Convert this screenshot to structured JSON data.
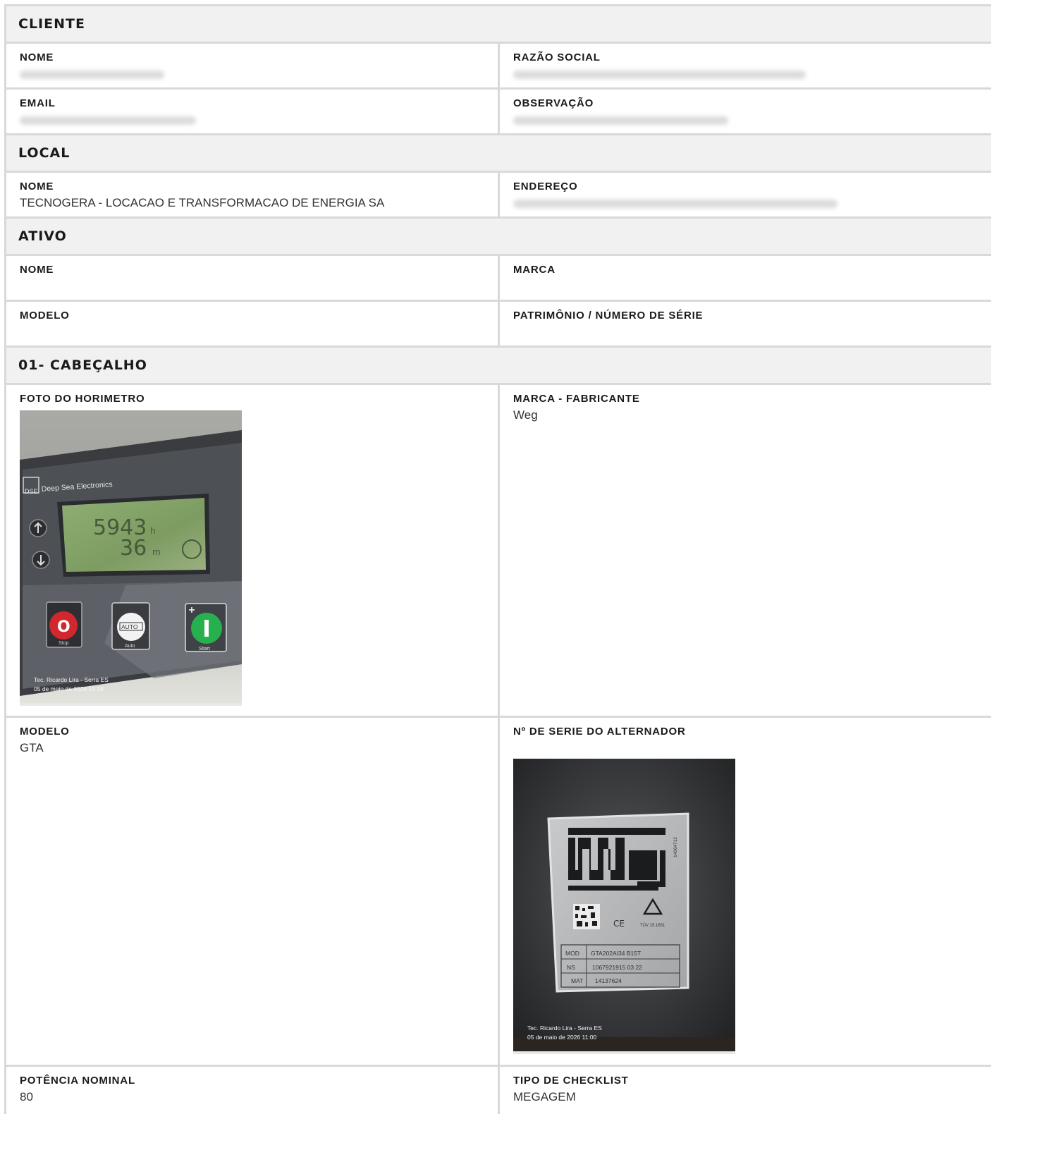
{
  "cliente": {
    "title": "CLIENTE",
    "nome_label": "NOME",
    "razao_label": "RAZÃO SOCIAL",
    "email_label": "EMAIL",
    "obs_label": "OBSERVAÇÃO"
  },
  "local": {
    "title": "LOCAL",
    "nome_label": "NOME",
    "nome_value": "TECNOGERA - LOCACAO E TRANSFORMACAO DE ENERGIA SA",
    "endereco_label": "ENDEREÇO"
  },
  "ativo": {
    "title": "ATIVO",
    "nome_label": "NOME",
    "marca_label": "MARCA",
    "modelo_label": "MODELO",
    "patrimonio_label": "PATRIMÔNIO / NÚMERO DE SÉRIE"
  },
  "cabecalho": {
    "title": "01- CABEÇALHO",
    "foto_label": "FOTO DO HORIMETRO",
    "marca_label": "MARCA - FABRICANTE",
    "marca_value": "Weg",
    "modelo_label": "MODELO",
    "modelo_value": "GTA",
    "serie_label": "Nº DE SERIE DO ALTERNADOR",
    "potencia_label": "POTÊNCIA NOMINAL",
    "potencia_value": "80",
    "tipo_label": "TIPO DE CHECKLIST",
    "tipo_value": "MEGAGEM"
  },
  "photo_horimetro": {
    "brand": "Deep Sea Electronics",
    "brand_short": "DSE",
    "hours": "5943",
    "hours_unit": "h",
    "minutes": "36",
    "minutes_unit": "m",
    "stop_label": "Stop",
    "auto_button": "AUTO",
    "auto_label": "Auto",
    "start_label": "Start",
    "caption_line1": "Tec. Ricardo Lira - Serra ES",
    "caption_line2": "05 de maio de 2026 15:19"
  },
  "photo_alternador": {
    "logo": "weg",
    "code_vertical": "14064712",
    "cert": "TÜV 15.1651",
    "mod_label": "MOD",
    "mod_value": "GTA202AI34 B15T",
    "ns_label": "NS",
    "ns_value": "1067921915 03 22",
    "mat_label": "MAT",
    "mat_value": "14137624",
    "caption_line1": "Tec. Ricardo Lira - Serra ES",
    "caption_line2": "05 de maio de 2026 11:00"
  }
}
